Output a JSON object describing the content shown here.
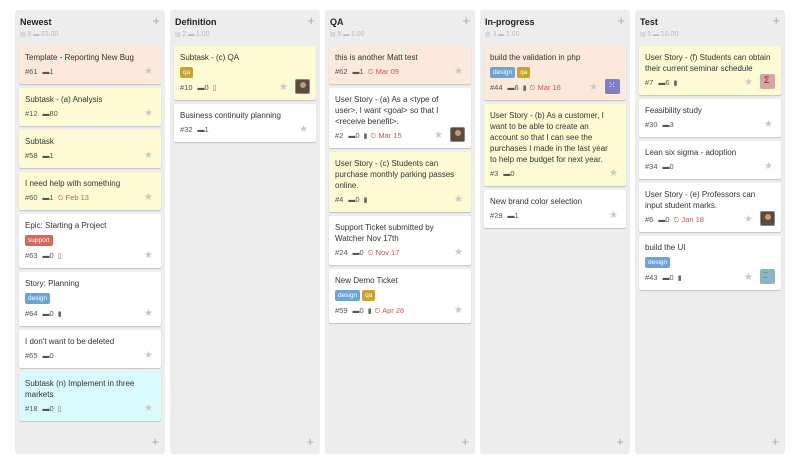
{
  "colors": {
    "column_bg": "#ededed",
    "card_bg": "#ffffff",
    "card_orange": "#fde8dc",
    "card_yellow": "#fdfbd3",
    "card_cyan": "#d9fbfd",
    "label_support": "#d9675b",
    "label_design": "#6ca4d9",
    "label_qa": "#c9a227",
    "due_red": "#d9534f"
  },
  "icons": {
    "add": "+",
    "star": "★",
    "comment": "▬",
    "bookmark": "▮",
    "clock": "⏲",
    "cards_count": "▤",
    "points": "▬"
  },
  "columns": [
    {
      "title": "Newest",
      "card_count": "8",
      "points": "83.00",
      "cards": [
        {
          "title": "Template - Reporting New Bug",
          "id": "#61",
          "comments": "1",
          "bg": "orange"
        },
        {
          "title": "Subtask - (a) Analysis",
          "id": "#12",
          "comments": "80",
          "bg": "yellow"
        },
        {
          "title": "Subtask",
          "id": "#58",
          "comments": "1",
          "bg": "yellow"
        },
        {
          "title": "I need help with something",
          "id": "#60",
          "comments": "1",
          "due": "Feb 13",
          "bg": "yellow"
        },
        {
          "title": "Epic: Starting a Project",
          "labels": [
            {
              "text": "support",
              "color": "support"
            }
          ],
          "id": "#63",
          "comments": "0",
          "bookmark": "outline"
        },
        {
          "title": "Story: Planning",
          "labels": [
            {
              "text": "design",
              "color": "design"
            }
          ],
          "id": "#64",
          "comments": "0",
          "bookmark": "filled"
        },
        {
          "title": "I don't want to be deleted",
          "id": "#65",
          "comments": "0"
        },
        {
          "title": "Subtask (n) Implement in three markets",
          "id": "#18",
          "comments": "0",
          "bookmark": "outline",
          "bg": "cyan"
        }
      ]
    },
    {
      "title": "Definition",
      "card_count": "2",
      "points": "1.00",
      "cards": [
        {
          "title": "Subtask - (c) QA",
          "labels": [
            {
              "text": "qa",
              "color": "qa"
            }
          ],
          "id": "#10",
          "comments": "0",
          "bookmark": "outline",
          "avatar": "photo",
          "bg": "yellow"
        },
        {
          "title": "Business continuity planning",
          "id": "#32",
          "comments": "1"
        }
      ]
    },
    {
      "title": "QA",
      "card_count": "5",
      "points": "1.00",
      "cards": [
        {
          "title": "this is another Matt test",
          "id": "#62",
          "comments": "1",
          "due": "Mar 09",
          "bg": "orange"
        },
        {
          "title": "User Story - (a) As a <type of user>, I want <goal> so that I <receive benefit>.",
          "id": "#2",
          "comments": "0",
          "bookmark": "filled",
          "due": "Mar 15",
          "avatar": "photo"
        },
        {
          "title": "User Story - (c) Students can purchase monthly parking passes online.",
          "id": "#4",
          "comments": "0",
          "bookmark": "filled",
          "bg": "yellow"
        },
        {
          "title": "Support Ticket submitted by Watcher Nov 17th",
          "id": "#24",
          "comments": "0",
          "due": "Nov 17"
        },
        {
          "title": "New Demo Ticket",
          "labels": [
            {
              "text": "design",
              "color": "design"
            },
            {
              "text": "qa",
              "color": "qa"
            }
          ],
          "id": "#59",
          "comments": "0",
          "bookmark": "filled",
          "due": "Apr 26"
        }
      ]
    },
    {
      "title": "In-progress",
      "card_count": "3",
      "points": "1.00",
      "cards": [
        {
          "title": "build the validation in php",
          "labels": [
            {
              "text": "design",
              "color": "design"
            },
            {
              "text": "qa",
              "color": "qa"
            }
          ],
          "id": "#44",
          "comments": "6",
          "bookmark": "filled",
          "due": "Mar 16",
          "avatar": "blue",
          "bg": "orange"
        },
        {
          "title": "User Story - (b) As a customer, I want to be able to create an account so that I can see the purchases I made in the last year to help me budget for next year.",
          "id": "#3",
          "comments": "0",
          "bg": "yellow"
        },
        {
          "title": "New brand color selection",
          "id": "#29",
          "comments": "1"
        }
      ]
    },
    {
      "title": "Test",
      "card_count": "5",
      "points": "10.00",
      "cards": [
        {
          "title": "User Story - (f) Students can obtain their current seminar schedule",
          "id": "#7",
          "comments": "6",
          "bookmark": "filled",
          "avatar": "pink",
          "bg": "yellow"
        },
        {
          "title": "Feasibility study",
          "id": "#30",
          "comments": "3"
        },
        {
          "title": "Lean six sigma - adoption",
          "id": "#34",
          "comments": "0"
        },
        {
          "title": "User Story - (e) Professors can input student marks.",
          "id": "#6",
          "comments": "0",
          "due": "Jan 18",
          "avatar": "photo"
        },
        {
          "title": "build the UI",
          "labels": [
            {
              "text": "design",
              "color": "design"
            }
          ],
          "id": "#43",
          "comments": "0",
          "bookmark": "filled",
          "avatar": "teal"
        }
      ]
    }
  ]
}
